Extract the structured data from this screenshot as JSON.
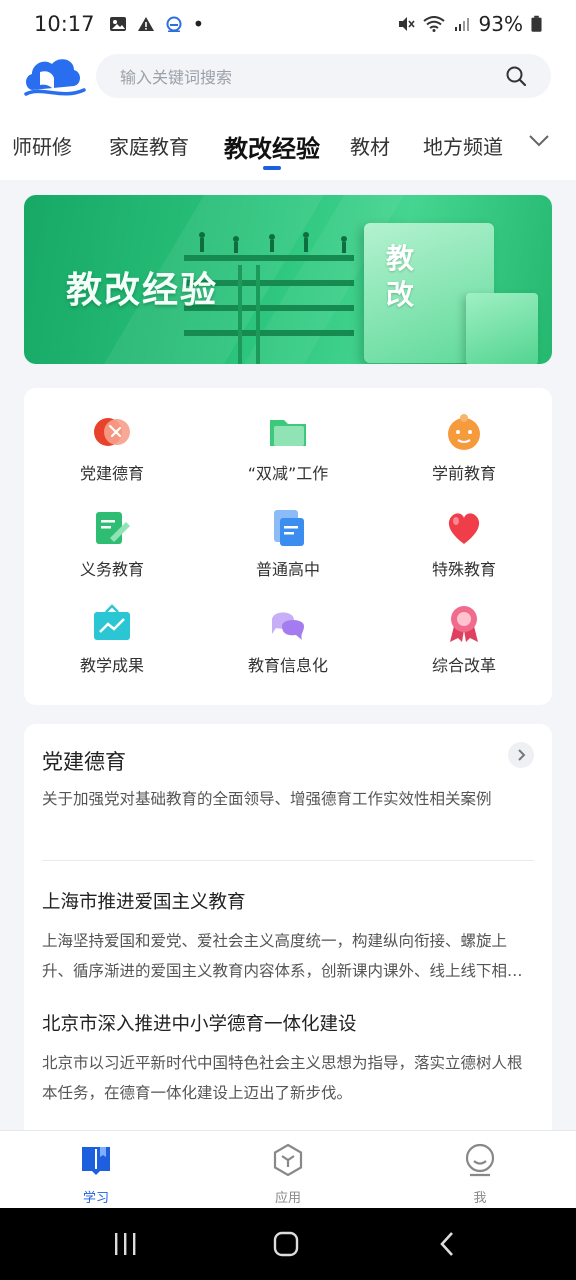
{
  "status_bar": {
    "time": "10:17",
    "battery": "93%",
    "dot": "•"
  },
  "search": {
    "placeholder": "输入关键词搜索"
  },
  "tabs": [
    {
      "label": "教师研修",
      "visible_label": "师研修"
    },
    {
      "label": "家庭教育"
    },
    {
      "label": "教改经验",
      "active": true
    },
    {
      "label": "教材"
    },
    {
      "label": "地方频道"
    }
  ],
  "banner": {
    "title": "教改经验",
    "book_text": "教改"
  },
  "categories": [
    {
      "label": "党建德育",
      "icon": "party-building-icon",
      "color": "#e8412c"
    },
    {
      "label": "“双减”工作",
      "icon": "folder-icon",
      "color": "#3cc97a"
    },
    {
      "label": "学前教育",
      "icon": "child-face-icon",
      "color": "#f59b3c"
    },
    {
      "label": "义务教育",
      "icon": "book-edit-icon",
      "color": "#2fbd74"
    },
    {
      "label": "普通高中",
      "icon": "document-stack-icon",
      "color": "#3b8ef0"
    },
    {
      "label": "特殊教育",
      "icon": "heart-icon",
      "color": "#ef3e4a"
    },
    {
      "label": "教学成果",
      "icon": "chart-board-icon",
      "color": "#2bc6d4"
    },
    {
      "label": "教育信息化",
      "icon": "chat-bubbles-icon",
      "color": "#a57cf0"
    },
    {
      "label": "综合改革",
      "icon": "medal-icon",
      "color": "#f06b8c"
    }
  ],
  "news": {
    "title": "党建德育",
    "description": "关于加强党对基础教育的全面领导、增强德育工作实效性相关案例",
    "articles": [
      {
        "title": "上海市推进爱国主义教育",
        "body": "上海坚持爱国和爱党、爱社会主义高度统一，构建纵向衔接、螺旋上升、循序渐进的爱国主义教育内容体系，创新课内课外、线上线下相结合的教育方式。"
      },
      {
        "title": "北京市深入推进中小学德育一体化建设",
        "body": "北京市以习近平新时代中国特色社会主义思想为指导，落实立德树人根本任务，在德育一体化建设上迈出了新步伐。"
      }
    ]
  },
  "bottom_nav": [
    {
      "label": "学习",
      "icon": "book-icon",
      "active": true
    },
    {
      "label": "应用",
      "icon": "apps-hexagon-icon"
    },
    {
      "label": "我",
      "icon": "profile-icon"
    }
  ],
  "colors": {
    "accent": "#1e5fe0",
    "banner_green": "#2cc57d"
  }
}
